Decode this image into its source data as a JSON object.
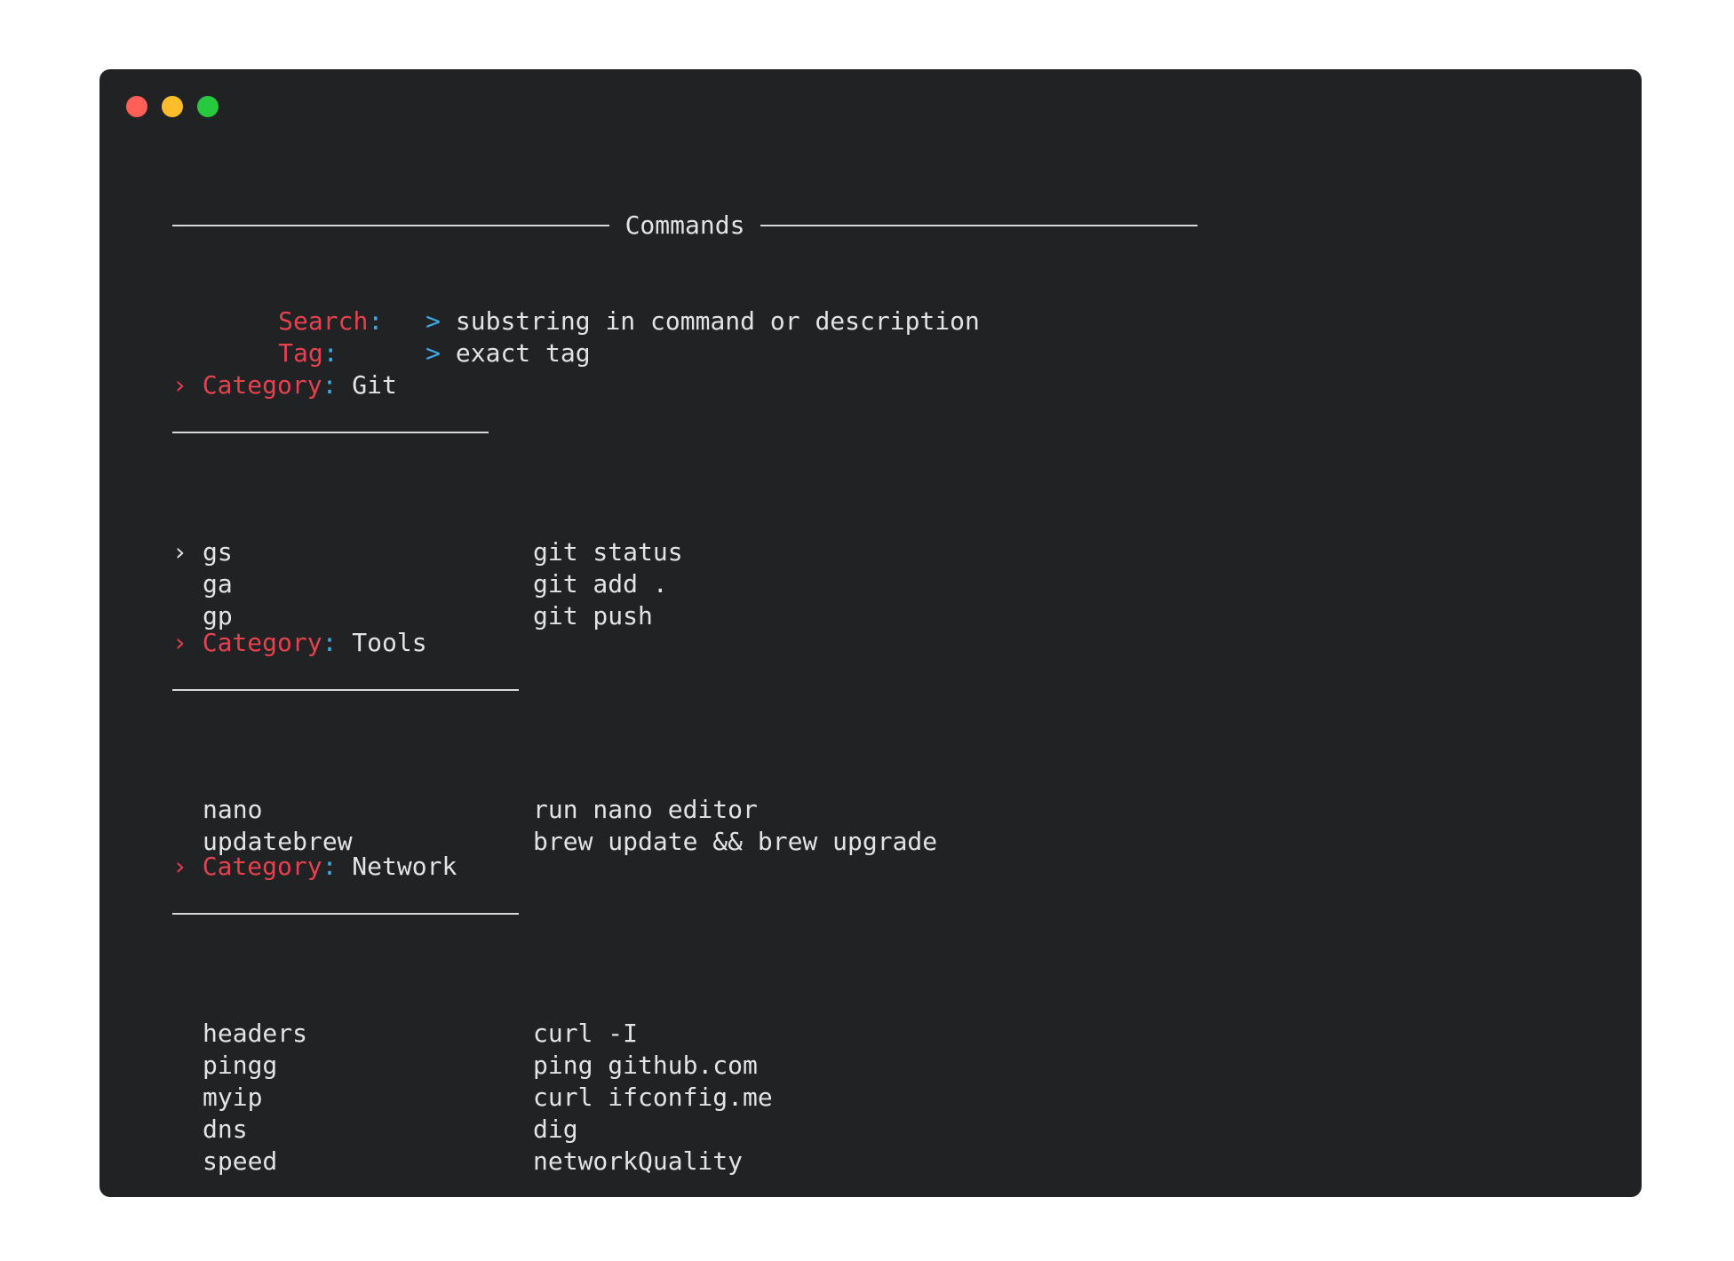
{
  "colors": {
    "window_bg": "#212224",
    "close": "#ff5f56",
    "minimize": "#ffbd2e",
    "maximize": "#27c93f",
    "label_red": "#e5414e",
    "accent_blue": "#3fa8e6",
    "text": "#e3e3e3"
  },
  "header": {
    "title": "Commands"
  },
  "filters": {
    "search_label": "Search",
    "search_hint": "substring in command or description",
    "tag_label": "Tag",
    "tag_hint": "exact tag",
    "prompt": ">",
    "colon": ":"
  },
  "category_label": "Category",
  "categories": [
    {
      "name": "Git",
      "items": [
        {
          "marker": "›",
          "cmd": "gs",
          "desc": "git status"
        },
        {
          "marker": "",
          "cmd": "ga",
          "desc": "git add ."
        },
        {
          "marker": "",
          "cmd": "gp",
          "desc": "git push"
        }
      ]
    },
    {
      "name": "Tools",
      "items": [
        {
          "marker": "",
          "cmd": "nano",
          "desc": "run nano editor"
        },
        {
          "marker": "",
          "cmd": "updatebrew",
          "desc": "brew update && brew upgrade"
        }
      ]
    },
    {
      "name": "Network",
      "items": [
        {
          "marker": "",
          "cmd": "headers",
          "desc": "curl -I"
        },
        {
          "marker": "",
          "cmd": "pingg",
          "desc": "ping github.com"
        },
        {
          "marker": "",
          "cmd": "myip",
          "desc": "curl ifconfig.me"
        },
        {
          "marker": "",
          "cmd": "dns",
          "desc": "dig"
        },
        {
          "marker": "",
          "cmd": "speed",
          "desc": "networkQuality"
        }
      ]
    }
  ]
}
